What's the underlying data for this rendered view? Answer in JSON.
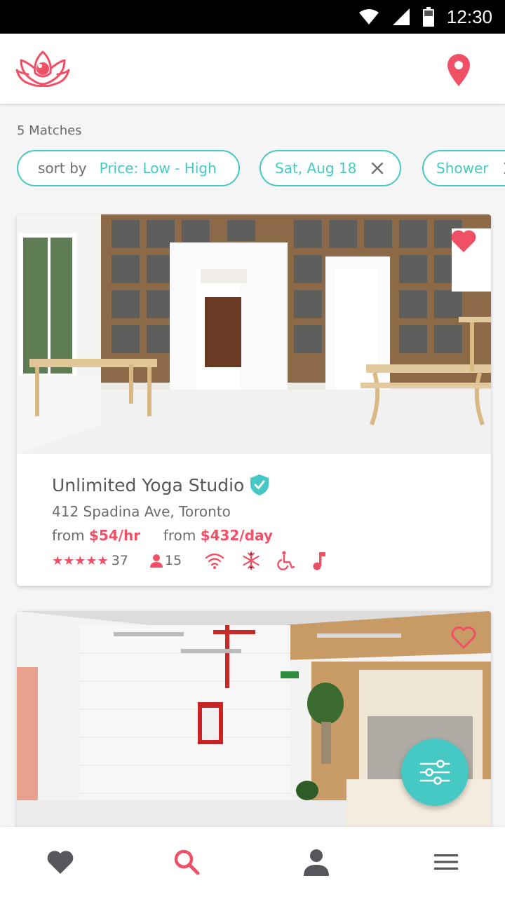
{
  "status_bar": {
    "time": "12:30"
  },
  "results": {
    "count_label": "5 Matches"
  },
  "filters": {
    "sort_label": "sort by",
    "sort_value": "Price: Low - High",
    "date": "Sat, Aug 18",
    "amenity": "Shower"
  },
  "listings": [
    {
      "title": "Unlimited Yoga Studio",
      "address": "412 Spadina Ave, Toronto",
      "from_label_hour": "from",
      "price_hour": "$54/hr",
      "from_label_day": "from",
      "price_day": "$432/day",
      "stars": "★★★★★",
      "reviews": "37",
      "capacity": "15",
      "favorited": true
    },
    {
      "favorited": false
    }
  ],
  "colors": {
    "accent": "#46c8c5",
    "brand": "#f05066",
    "text": "#55575d",
    "muted": "#6b6b70",
    "nav_icon": "#55575d"
  },
  "icons": {
    "logo": "lotus-logo-icon",
    "location": "map-pin-icon",
    "favorite": "heart-icon",
    "verified": "verified-shield-icon",
    "wifi": "wifi-icon",
    "ac": "snowflake-icon",
    "accessible": "wheelchair-icon",
    "music": "music-note-icon",
    "filter": "sliders-icon",
    "nav": [
      "heart-icon",
      "search-icon",
      "person-icon",
      "menu-icon"
    ]
  }
}
